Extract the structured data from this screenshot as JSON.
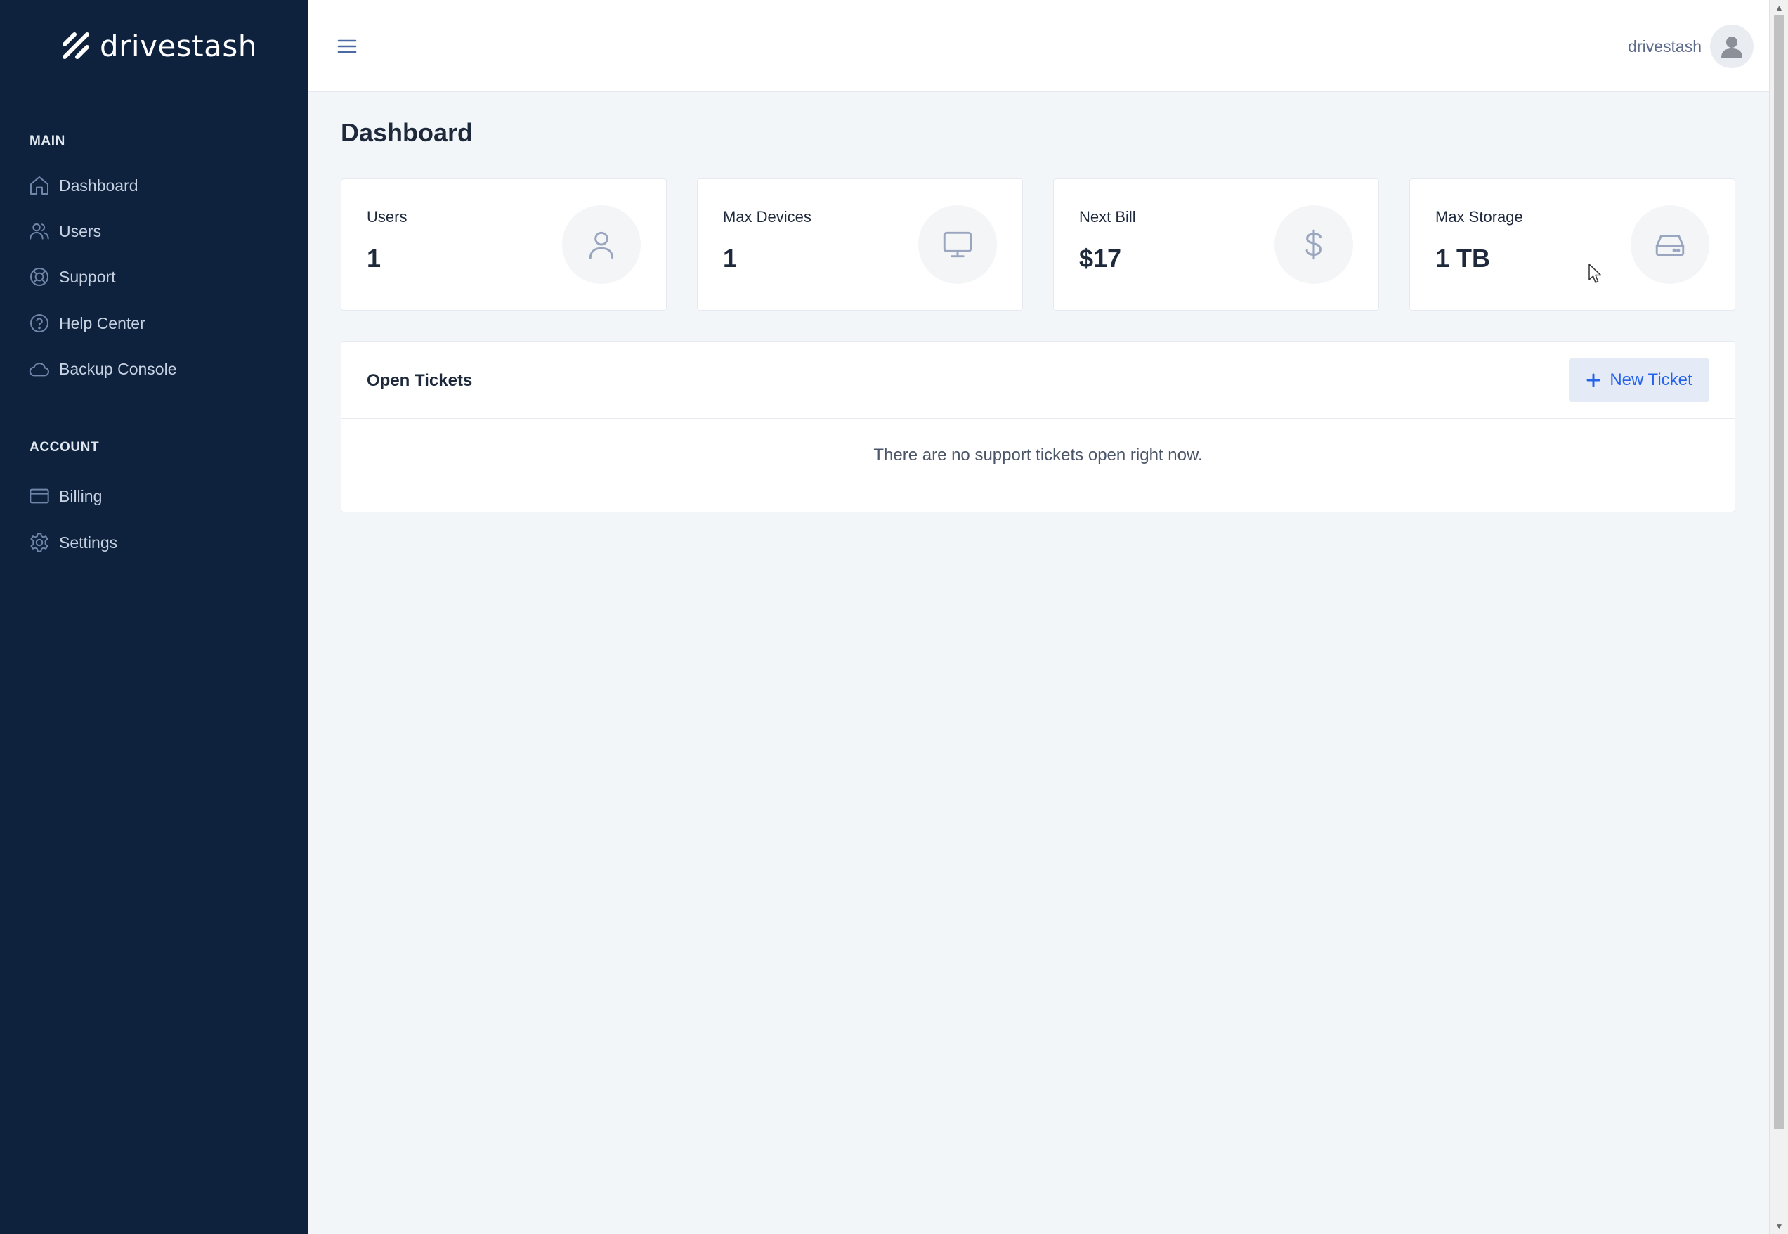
{
  "brand": {
    "name": "drivestash"
  },
  "sidebar": {
    "main_heading": "MAIN",
    "account_heading": "ACCOUNT",
    "main_items": [
      {
        "label": "Dashboard",
        "icon": "home-icon"
      },
      {
        "label": "Users",
        "icon": "users-icon"
      },
      {
        "label": "Support",
        "icon": "lifebuoy-icon"
      },
      {
        "label": "Help Center",
        "icon": "question-circle-icon"
      },
      {
        "label": "Backup Console",
        "icon": "cloud-icon"
      }
    ],
    "account_items": [
      {
        "label": "Billing",
        "icon": "credit-card-icon"
      },
      {
        "label": "Settings",
        "icon": "gear-icon"
      }
    ]
  },
  "topbar": {
    "username": "drivestash"
  },
  "main": {
    "title": "Dashboard",
    "stats": [
      {
        "label": "Users",
        "value": "1",
        "icon": "user-icon"
      },
      {
        "label": "Max Devices",
        "value": "1",
        "icon": "monitor-icon"
      },
      {
        "label": "Next Bill",
        "value": "$17",
        "icon": "dollar-icon"
      },
      {
        "label": "Max Storage",
        "value": "1 TB",
        "icon": "hard-drive-icon"
      }
    ],
    "tickets": {
      "title": "Open Tickets",
      "new_button": "New Ticket",
      "empty_message": "There are no support tickets open right now."
    }
  },
  "colors": {
    "sidebar_bg": "#0e223d",
    "accent": "#2563eb",
    "page_bg": "#f3f6f9"
  }
}
